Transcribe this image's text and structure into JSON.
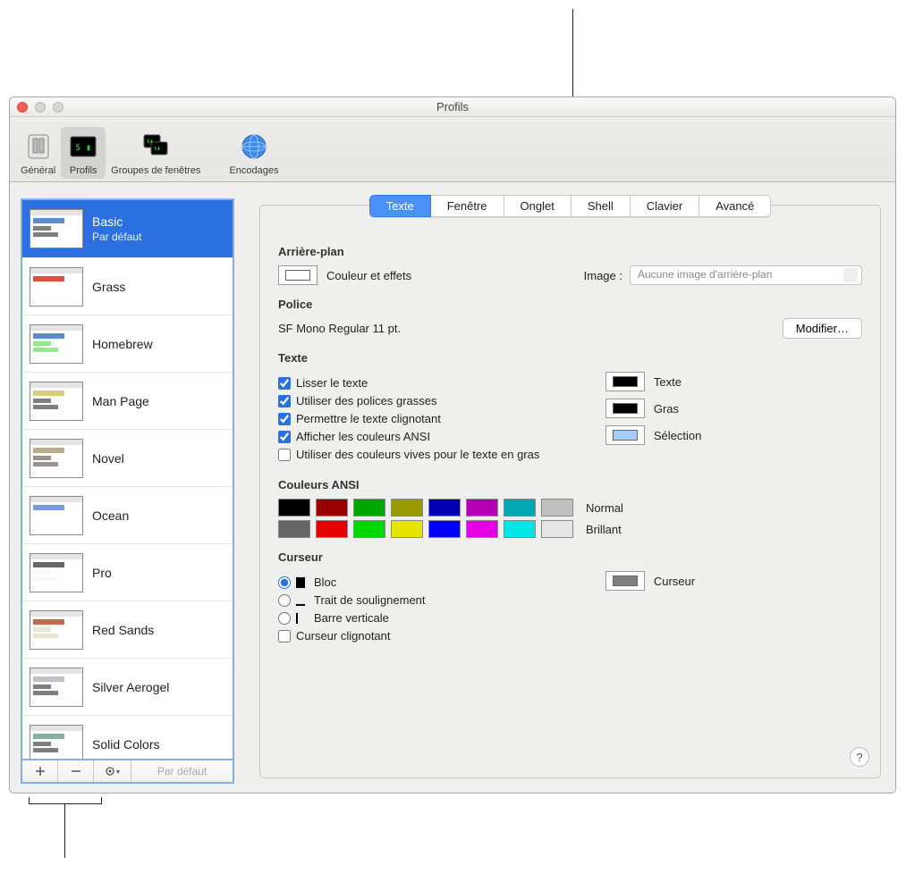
{
  "window": {
    "title": "Profils"
  },
  "toolbar": {
    "items": [
      {
        "label": "Général"
      },
      {
        "label": "Profils"
      },
      {
        "label": "Groupes de fenêtres"
      },
      {
        "label": "Encodages"
      }
    ]
  },
  "sidebar": {
    "profiles": [
      {
        "name": "Basic",
        "sub": "Par défaut",
        "bg": "#ffffff",
        "fg": "#000000",
        "accent": "#4a80c8"
      },
      {
        "name": "Grass",
        "bg": "#13773d",
        "fg": "#ffffff",
        "accent": "#d83e2c"
      },
      {
        "name": "Homebrew",
        "bg": "#000000",
        "fg": "#29d11c",
        "accent": "#4a80c8"
      },
      {
        "name": "Man Page",
        "bg": "#fef49c",
        "fg": "#000000",
        "accent": "#d4c86c"
      },
      {
        "name": "Novel",
        "bg": "#dfdbc3",
        "fg": "#3b2322",
        "accent": "#b0a57f"
      },
      {
        "name": "Ocean",
        "bg": "#224fbc",
        "fg": "#ffffff",
        "accent": "#6c8fe4"
      },
      {
        "name": "Pro",
        "bg": "#111111",
        "fg": "#f2f2f2",
        "accent": "#555555"
      },
      {
        "name": "Red Sands",
        "bg": "#7a251e",
        "fg": "#d7c9a7",
        "accent": "#b85a3c"
      },
      {
        "name": "Silver Aerogel",
        "bg": "#8a9196",
        "fg": "#000000",
        "accent": "#b7bdc2"
      },
      {
        "name": "Solid Colors",
        "bg": "#5a8b7a",
        "fg": "#000000",
        "accent": "#7aa996"
      }
    ],
    "footer_default": "Par défaut"
  },
  "tabs": [
    "Texte",
    "Fenêtre",
    "Onglet",
    "Shell",
    "Clavier",
    "Avancé"
  ],
  "sections": {
    "background": {
      "title": "Arrière-plan",
      "color_effects": "Couleur et effets",
      "image_label": "Image :",
      "image_select": "Aucune image d'arrière-plan"
    },
    "font": {
      "title": "Police",
      "value": "SF Mono Regular 11 pt.",
      "modify": "Modifier…"
    },
    "text": {
      "title": "Texte",
      "checks": [
        "Lisser le texte",
        "Utiliser des polices grasses",
        "Permettre le texte clignotant",
        "Afficher les couleurs ANSI",
        "Utiliser des couleurs vives pour le texte en gras"
      ],
      "wells": [
        {
          "label": "Texte",
          "color": "#000000"
        },
        {
          "label": "Gras",
          "color": "#000000"
        },
        {
          "label": "Sélection",
          "color": "#a4cdff"
        }
      ]
    },
    "ansi": {
      "title": "Couleurs ANSI",
      "rows": [
        {
          "label": "Normal",
          "colors": [
            "#000000",
            "#990000",
            "#00a600",
            "#999900",
            "#0000b2",
            "#b200b2",
            "#00a6b2",
            "#bfbfbf"
          ]
        },
        {
          "label": "Brillant",
          "colors": [
            "#666666",
            "#e50000",
            "#00d900",
            "#e5e500",
            "#0000ff",
            "#e500e5",
            "#00e5e5",
            "#e5e5e5"
          ]
        }
      ]
    },
    "cursor": {
      "title": "Curseur",
      "radios": [
        "Bloc",
        "Trait de soulignement",
        "Barre verticale"
      ],
      "blink": "Curseur clignotant",
      "well_label": "Curseur",
      "well_color": "#7f7f7f"
    }
  }
}
